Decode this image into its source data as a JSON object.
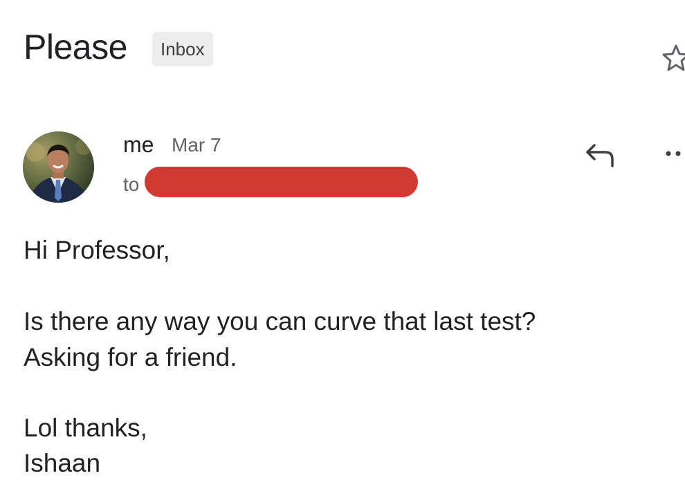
{
  "email": {
    "subject": "Please",
    "label": "Inbox",
    "sender": "me",
    "date": "Mar 7",
    "to_label": "to",
    "body": {
      "greeting": "Hi Professor,",
      "line1": "Is there any way you can curve that last test?",
      "line2": "Asking for a friend.",
      "signoff": "Lol thanks,",
      "signature": "Ishaan"
    }
  },
  "icons": {
    "star": "star-outline-icon",
    "reply": "reply-arrow-icon",
    "more": "more-dots-icon"
  },
  "colors": {
    "redaction": "#d13a30",
    "chip_bg": "#ededed",
    "text": "#202124",
    "secondary_text": "#5f6368"
  }
}
